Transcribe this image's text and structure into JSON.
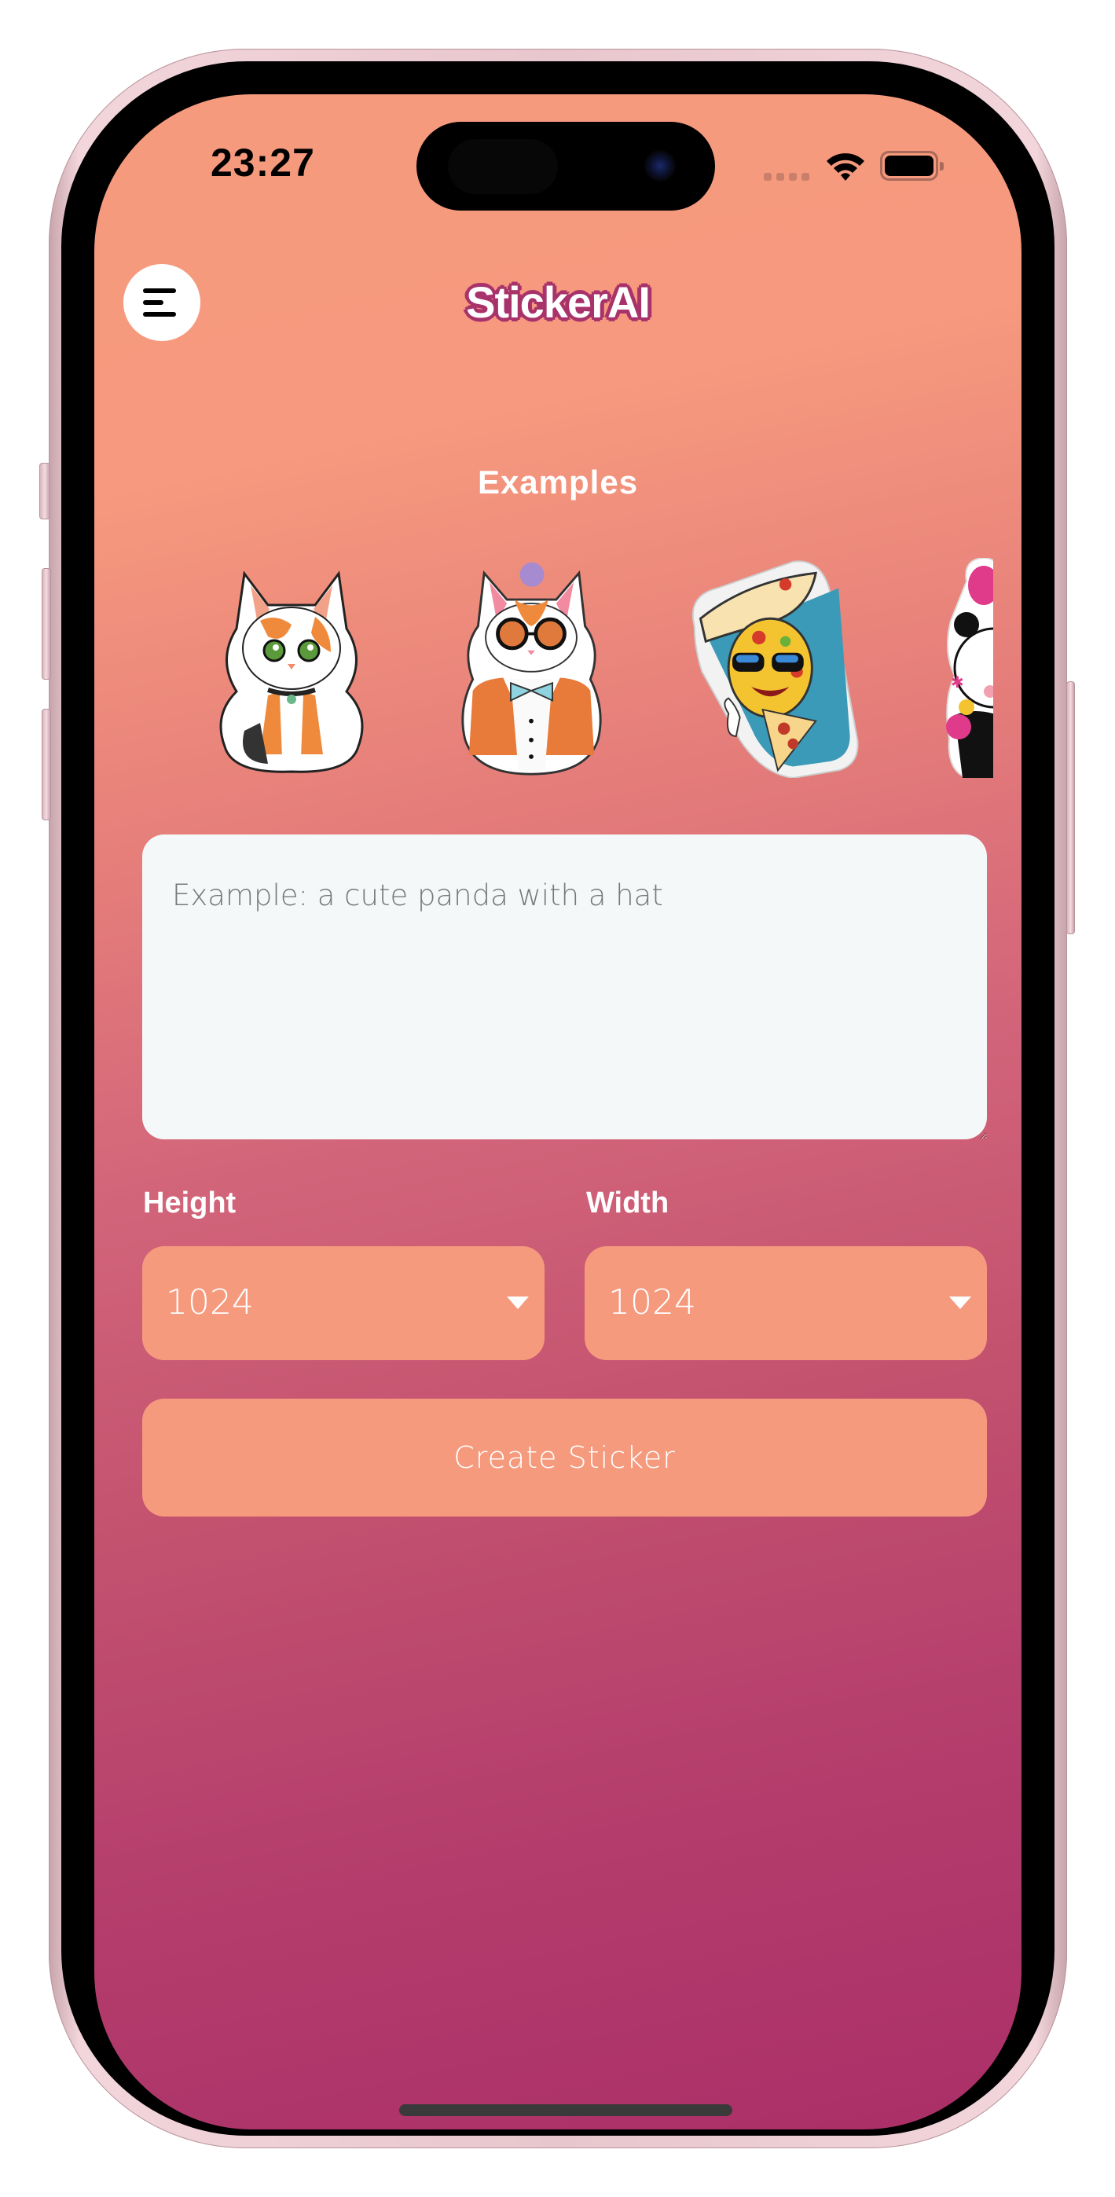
{
  "status_bar": {
    "time": "23:27",
    "signal_icon": "cellular-signal-icon",
    "wifi_icon": "wifi-icon",
    "battery_icon": "battery-icon"
  },
  "header": {
    "menu_icon": "hamburger-menu-icon",
    "title": "StickerAI",
    "title_colors": {
      "fill": "#ffffff",
      "outline": "#a8326a"
    }
  },
  "examples": {
    "title": "Examples",
    "items": [
      {
        "name": "cute-calico-kitten",
        "label": "Cute kitten sticker"
      },
      {
        "name": "cat-with-glasses-and-bowtie",
        "label": "Cat in suit sticker"
      },
      {
        "name": "cool-pizza-with-sunglasses",
        "label": "Pizza sticker"
      },
      {
        "name": "party-panda-with-balloons",
        "label": "Panda sticker"
      }
    ]
  },
  "prompt": {
    "value": "",
    "placeholder": "Example: a cute panda with a hat"
  },
  "height_select": {
    "label": "Height",
    "value": "1024"
  },
  "width_select": {
    "label": "Width",
    "value": "1024"
  },
  "create_button": {
    "label": "Create Sticker"
  },
  "colors": {
    "accent": "#f69a7e",
    "gradient_top": "#f69a7e",
    "gradient_bottom": "#aa2f68",
    "input_bg": "#f4f8f9"
  }
}
